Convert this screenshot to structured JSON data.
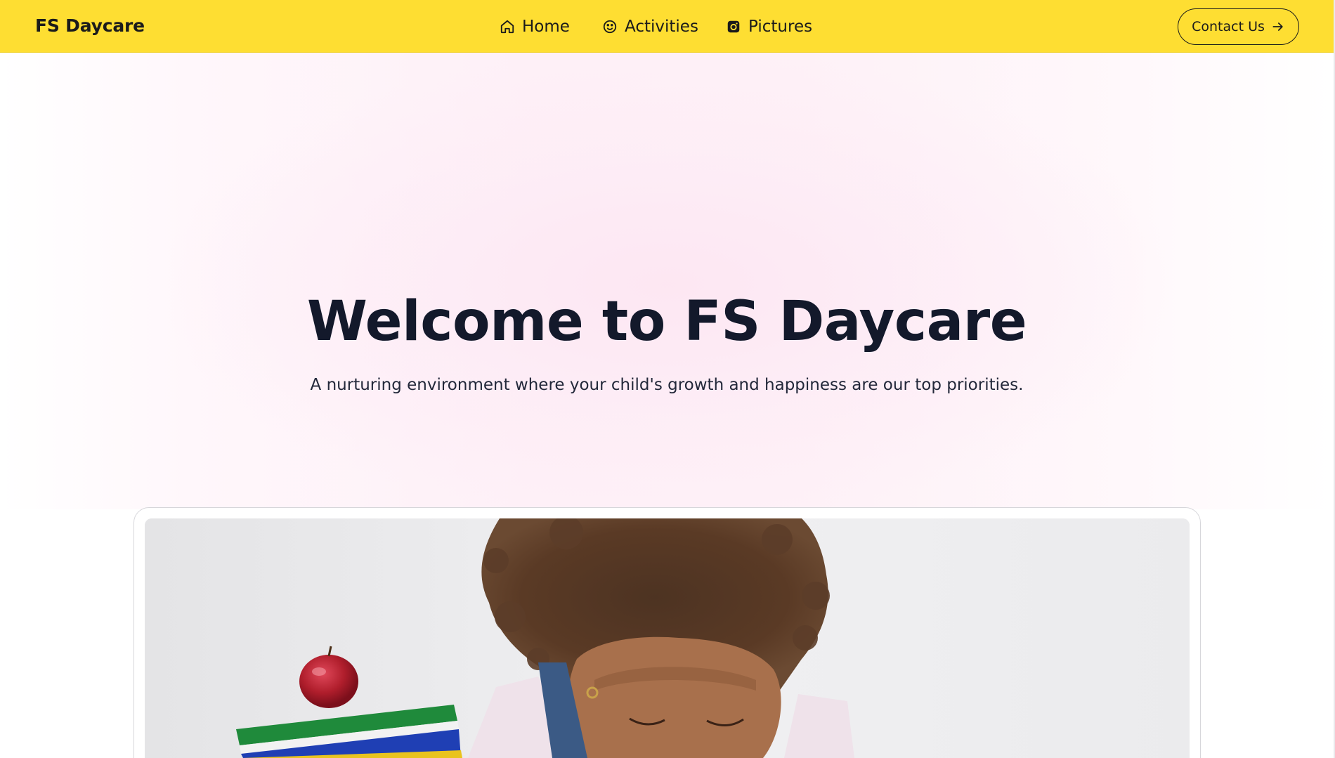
{
  "header": {
    "brand": "FS Daycare",
    "nav": [
      {
        "label": "Home",
        "icon": "home-icon"
      },
      {
        "label": "Activities",
        "icon": "smile-icon"
      },
      {
        "label": "Pictures",
        "icon": "instagram-icon"
      }
    ],
    "contact_label": "Contact Us",
    "contact_icon": "arrow-right-icon"
  },
  "hero": {
    "title": "Welcome to FS Daycare",
    "subtitle": "A nurturing environment where your child's growth and happiness are our top priorities."
  },
  "colors": {
    "header_bg": "#fede32",
    "title_text": "#13192b",
    "hero_tint": "#fef0f7"
  }
}
